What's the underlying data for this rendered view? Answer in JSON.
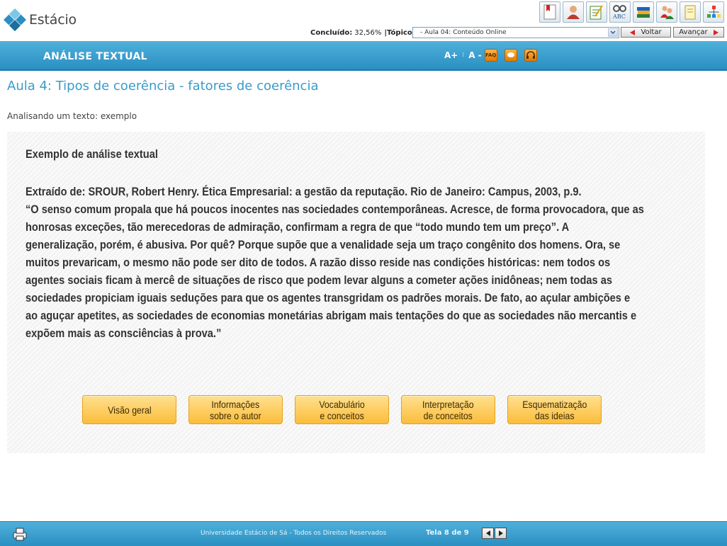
{
  "header": {
    "logo_text": "Estácio",
    "progress_label": "Concluído:",
    "progress_value": "32,56%",
    "topic_label": "|Tópico",
    "topic_selected": "- Aula 04: Conteúdo Online",
    "back_label": "Voltar",
    "next_label": "Avançar",
    "toolbar_icons": [
      "bookmark-icon",
      "profile-icon",
      "notepad-icon",
      "spellcheck-icon",
      "library-icon",
      "users-icon",
      "notes-icon",
      "tree-icon"
    ]
  },
  "section": {
    "title": "ANÁLISE TEXTUAL",
    "font_increase": "A+",
    "font_decrease": "A -",
    "faq_label": "FAQ"
  },
  "lesson": {
    "title": "Aula 4: Tipos de coerência - fatores de coerência",
    "subtitle": "Analisando um texto: exemplo"
  },
  "panel": {
    "heading": "Exemplo de análise textual",
    "lines": [
      "Extraído de: SROUR, Robert Henry. Ética Empresarial: a gestão da reputação. Rio de Janeiro: Campus, 2003, p.9.",
      "“O senso comum propala que há poucos inocentes nas sociedades contemporâneas. Acresce, de forma provocadora, que as",
      "honrosas exceções, tão merecedoras de admiração, confirmam a regra de que “todo mundo tem um preço”. A",
      "generalização, porém, é abusiva. Por quê? Porque supõe que a venalidade seja um traço congênito dos homens. Ora, se",
      "muitos prevaricam, o mesmo não pode ser dito de todos. A razão disso reside nas condições históricas: nem todos os",
      "agentes sociais ficam à mercê de situações de risco que podem levar alguns a cometer ações inidôneas; nem todas as",
      "sociedades propiciam iguais  seduções para que os agentes transgridam os padrões morais. De fato, ao açular ambições e",
      "ao aguçar apetites, as sociedades de economias monetárias abrigam mais tentações do que as sociedades não mercantis e",
      "expõem mais as consciências à prova.”"
    ],
    "buttons": [
      {
        "line1": "Visão  geral",
        "line2": ""
      },
      {
        "line1": "Informações",
        "line2": "sobre o autor"
      },
      {
        "line1": "Vocabulário",
        "line2": "e conceitos"
      },
      {
        "line1": "Interpretação",
        "line2": "de conceitos"
      },
      {
        "line1": "Esquematização",
        "line2": "das ideias"
      }
    ]
  },
  "footer": {
    "copyright": "Universidade Estácio de Sá - Todos os Direitos Reservados",
    "screen_count": "Tela 8 de 9"
  },
  "colors": {
    "brand_blue": "#2a8fc2",
    "title_blue": "#3a9bc9",
    "button_gold": "#fbbd3b",
    "accent_red": "#d9232a"
  }
}
